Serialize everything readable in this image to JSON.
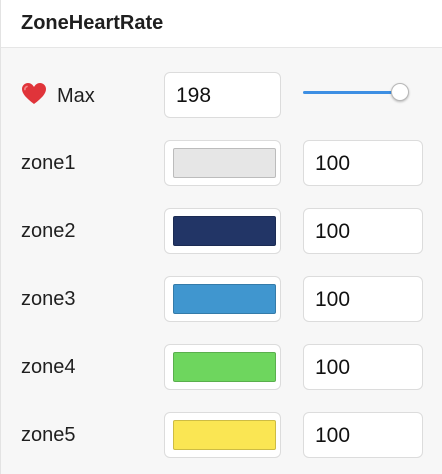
{
  "panel": {
    "title": "ZoneHeartRate"
  },
  "max": {
    "icon": "heart-icon",
    "label": "Max",
    "value": "198",
    "slider_fraction": 0.9,
    "slider_color": "#3d8fe3"
  },
  "zones": [
    {
      "label": "zone1",
      "color": "#e6e6e6",
      "value": "100"
    },
    {
      "label": "zone2",
      "color": "#223566",
      "value": "100"
    },
    {
      "label": "zone3",
      "color": "#4096cf",
      "value": "100"
    },
    {
      "label": "zone4",
      "color": "#6ed65e",
      "value": "100"
    },
    {
      "label": "zone5",
      "color": "#fae653",
      "value": "100"
    }
  ]
}
